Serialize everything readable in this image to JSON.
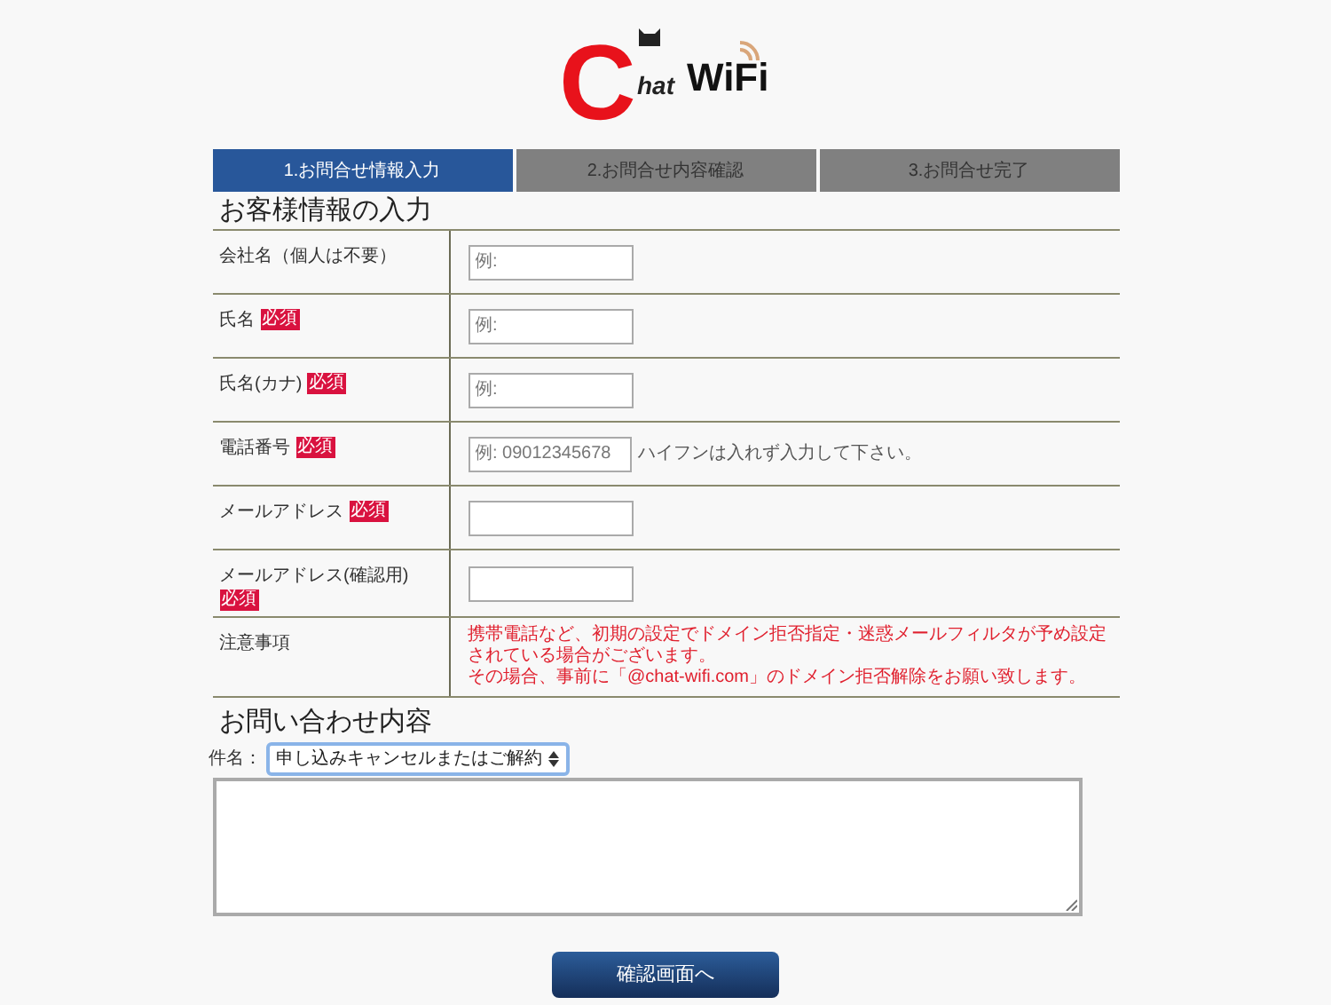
{
  "logo": {
    "letter": "C",
    "rest": "hat",
    "wifi": "WiFi"
  },
  "steps": [
    {
      "label": "1.お問合せ情報入力",
      "selected": true
    },
    {
      "label": "2.お問合せ内容確認",
      "selected": false
    },
    {
      "label": "3.お問合せ完了",
      "selected": false
    }
  ],
  "customer_section": {
    "title": "お客様情報の入力",
    "rows": [
      {
        "kind": "input",
        "label": "会社名（個人は不要）",
        "placeholder": "例:"
      },
      {
        "kind": "input",
        "label": "氏名",
        "badge": "必須",
        "placeholder": "例:"
      },
      {
        "kind": "input",
        "label": "氏名(カナ)",
        "badge": "必須",
        "placeholder": "例:"
      },
      {
        "kind": "input",
        "label": "電話番号",
        "badge": "必須",
        "placeholder": "例: 09012345678",
        "hint": "ハイフンは入れず入力して下さい。"
      },
      {
        "kind": "input",
        "label": "メールアドレス",
        "badge": "必須"
      },
      {
        "kind": "input",
        "label": "メールアドレス",
        "sublabel": "(確認用)",
        "badge": "必須"
      },
      {
        "kind": "note",
        "label": "注意事項",
        "lines": [
          "携帯電話など、初期の設定でドメイン拒否指定・迷惑メールフィルタが予め設定されている場合がございます。",
          "その場合、事前に「@chat-wifi.com」のドメイン拒否解除をお願い致します。"
        ]
      }
    ]
  },
  "inquiry_section": {
    "title": "お問い合わせ内容",
    "subject_label": "件名：",
    "subject_value": "申し込みキャンセルまたはご解約"
  },
  "submit_button": "確認画面へ"
}
